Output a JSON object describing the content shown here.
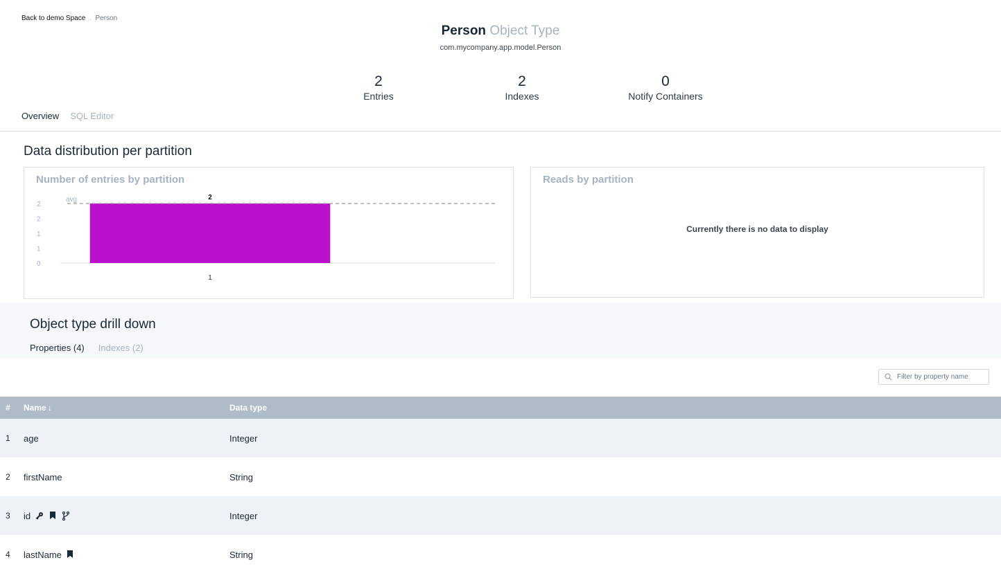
{
  "breadcrumb": {
    "back": "Back to demo Space",
    "separator": ".",
    "current": "Person"
  },
  "header": {
    "name": "Person",
    "type_label": "Object Type",
    "classname": "com.mycompany.app.model.Person"
  },
  "stats": [
    {
      "value": "2",
      "label": "Entries"
    },
    {
      "value": "2",
      "label": "Indexes"
    },
    {
      "value": "0",
      "label": "Notify Containers"
    }
  ],
  "top_tabs": [
    {
      "label": "Overview",
      "active": true
    },
    {
      "label": "SQL Editor",
      "active": false
    }
  ],
  "section_title": "Data distribution per partition",
  "entries_panel": {
    "title": "Number of entries by partition"
  },
  "reads_panel": {
    "title": "Reads by partition",
    "empty_message": "Currently there is no data to display"
  },
  "chart_data": {
    "type": "bar",
    "title": "Number of entries by partition",
    "categories": [
      "1"
    ],
    "values": [
      2
    ],
    "data_labels": [
      "2"
    ],
    "y_tick_labels": [
      "0",
      "1",
      "1",
      "2",
      "2"
    ],
    "ylim": [
      0,
      2
    ],
    "avg_line": {
      "value": 2,
      "label": "avg"
    },
    "bar_color": "#bb11cc"
  },
  "drilldown": {
    "title": "Object type drill down",
    "tabs": [
      {
        "label": "Properties (4)",
        "active": true
      },
      {
        "label": "Indexes (2)",
        "active": false
      }
    ]
  },
  "filter": {
    "placeholder": "Filter by property name",
    "icon": "search-icon"
  },
  "table": {
    "headers": {
      "num": "#",
      "name": "Name",
      "sort_indicator": "↓",
      "type": "Data type"
    },
    "rows": [
      {
        "num": "1",
        "name": "age",
        "type": "Integer",
        "icons": []
      },
      {
        "num": "2",
        "name": "firstName",
        "type": "String",
        "icons": []
      },
      {
        "num": "3",
        "name": "id",
        "type": "Integer",
        "icons": [
          "key-icon",
          "bookmark-icon",
          "routing-icon"
        ]
      },
      {
        "num": "4",
        "name": "lastName",
        "type": "String",
        "icons": [
          "bookmark-icon"
        ]
      }
    ]
  },
  "colors": {
    "accent_bar": "#bb11cc",
    "table_header": "#aebcc8",
    "muted": "#a7b3bf"
  }
}
